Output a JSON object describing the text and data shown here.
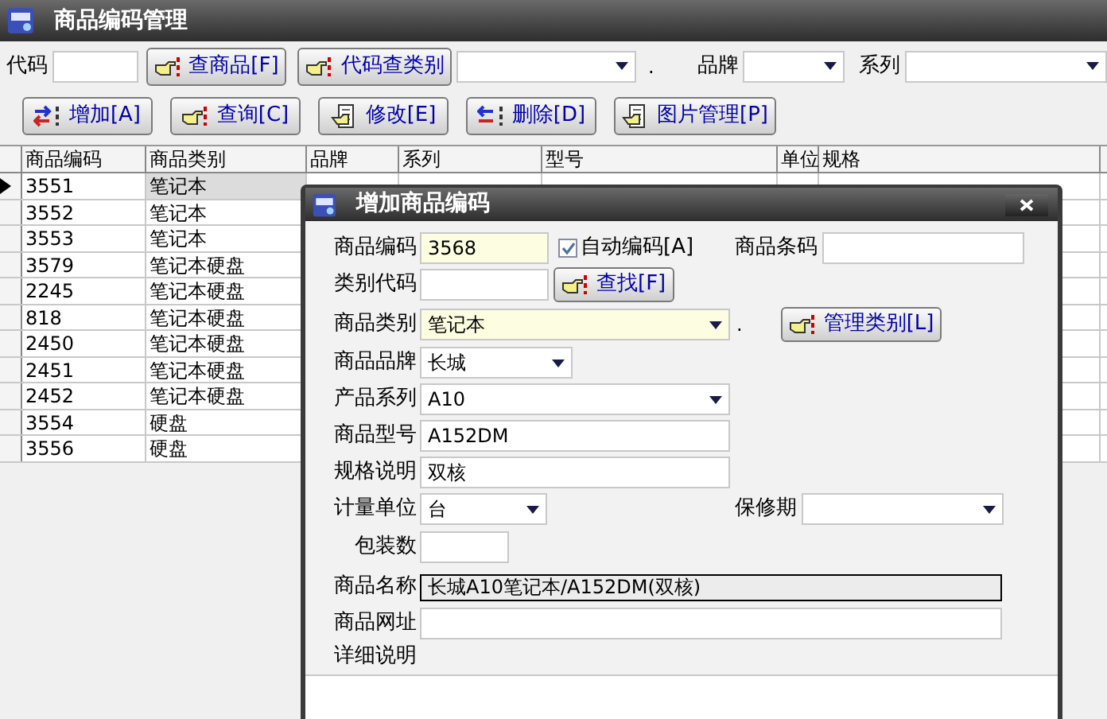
{
  "window": {
    "title": "商品编码管理"
  },
  "filter_bar": {
    "code_label": "代码",
    "buttons": [
      {
        "label": "查商品[F]",
        "kind": "hand"
      },
      {
        "label": "代码查类别",
        "kind": "hand"
      }
    ],
    "dot": ".",
    "brand_label": "品牌",
    "series_label": "系列"
  },
  "toolbar": [
    {
      "label": "增加[A]",
      "kind": "add"
    },
    {
      "label": "查询[C]",
      "kind": "hand"
    },
    {
      "label": "修改[E]",
      "kind": "edit"
    },
    {
      "label": "删除[D]",
      "kind": "delete"
    },
    {
      "label": "图片管理[P]",
      "kind": "edit"
    }
  ],
  "table": {
    "columns": [
      "商品编码",
      "商品类别",
      "品牌",
      "系列",
      "型号",
      "单位",
      "规格"
    ],
    "rows": [
      {
        "cells": [
          "3551",
          "笔记本"
        ],
        "selected": true
      },
      {
        "cells": [
          "3552",
          "笔记本"
        ],
        "selected": false
      },
      {
        "cells": [
          "3553",
          "笔记本"
        ],
        "selected": false
      },
      {
        "cells": [
          "3579",
          "笔记本硬盘"
        ],
        "selected": false
      },
      {
        "cells": [
          "2245",
          "笔记本硬盘"
        ],
        "selected": false
      },
      {
        "cells": [
          "818",
          "笔记本硬盘"
        ],
        "selected": false
      },
      {
        "cells": [
          "2450",
          "笔记本硬盘"
        ],
        "selected": false
      },
      {
        "cells": [
          "2451",
          "笔记本硬盘"
        ],
        "selected": false
      },
      {
        "cells": [
          "2452",
          "笔记本硬盘"
        ],
        "selected": false
      },
      {
        "cells": [
          "3554",
          "硬盘"
        ],
        "selected": false
      },
      {
        "cells": [
          "3556",
          "硬盘"
        ],
        "selected": false
      }
    ]
  },
  "dialog": {
    "title": "增加商品编码",
    "product_code": {
      "label": "商品编码",
      "value": "3568"
    },
    "auto_code": {
      "label": "自动编码[A]",
      "checked": true
    },
    "barcode": {
      "label": "商品条码"
    },
    "category_code": {
      "label": "类别代码"
    },
    "find_button": "查找[F]",
    "category": {
      "label": "商品类别",
      "value": "笔记本"
    },
    "dot": ".",
    "manage_button": "管理类别[L]",
    "brand": {
      "label": "商品品牌",
      "value": "长城"
    },
    "series": {
      "label": "产品系列",
      "value": "A10"
    },
    "model": {
      "label": "商品型号",
      "value": "A152DM"
    },
    "spec": {
      "label": "规格说明",
      "value": "双核"
    },
    "unit": {
      "label": "计量单位",
      "value": "台"
    },
    "warranty": {
      "label": "保修期"
    },
    "pack": {
      "label": "包装数"
    },
    "name": {
      "label": "商品名称",
      "value": "长城A10笔记本/A152DM(双核)"
    },
    "url": {
      "label": "商品网址"
    },
    "details": {
      "label": "详细说明"
    }
  }
}
